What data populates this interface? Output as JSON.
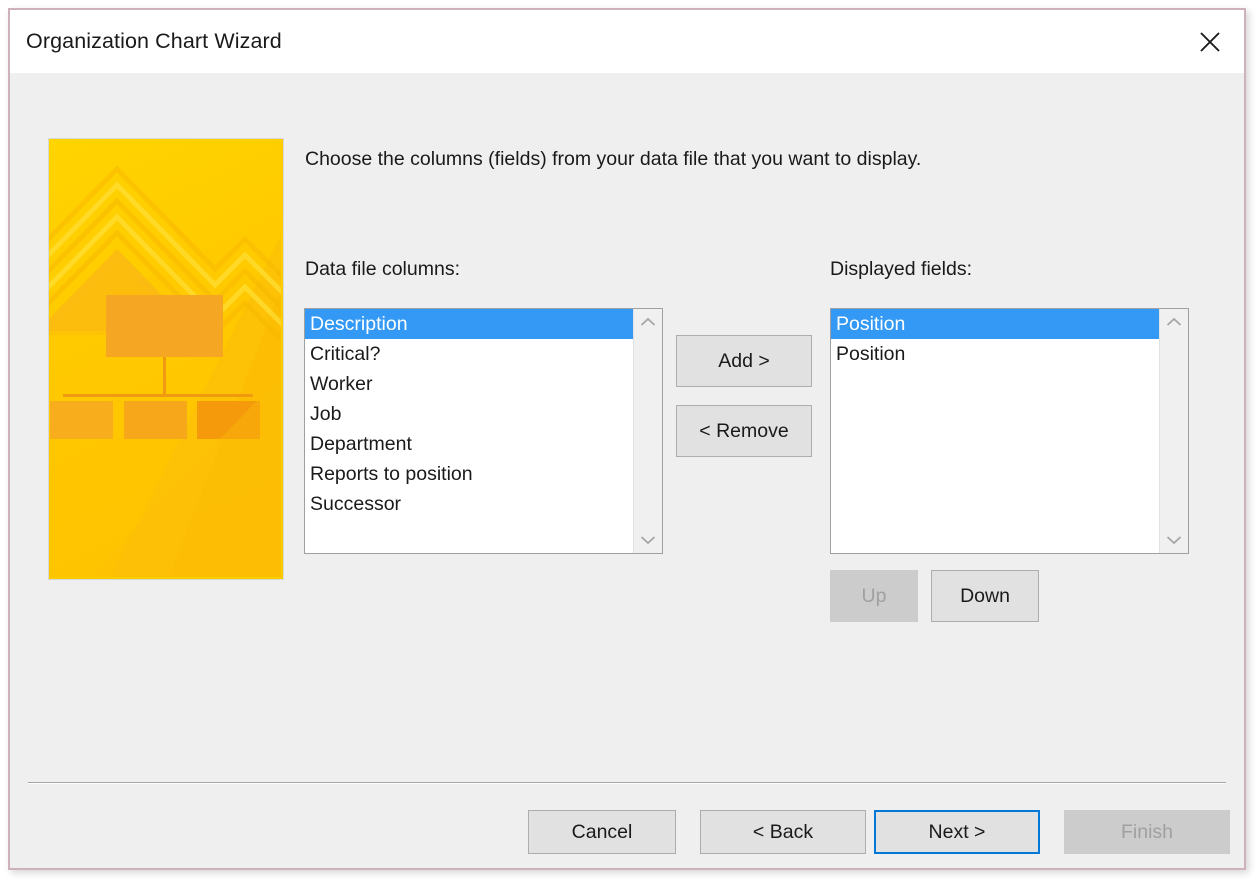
{
  "window": {
    "title": "Organization Chart Wizard",
    "close_icon": "close-icon"
  },
  "content": {
    "instruction": "Choose the columns (fields) from your data file that you want to display.",
    "left_label": "Data file columns:",
    "right_label": "Displayed fields:"
  },
  "data_file_columns": {
    "items": [
      {
        "label": "Description",
        "selected": true
      },
      {
        "label": "Critical?",
        "selected": false
      },
      {
        "label": "Worker",
        "selected": false
      },
      {
        "label": "Job",
        "selected": false
      },
      {
        "label": "Department",
        "selected": false
      },
      {
        "label": "Reports to position",
        "selected": false
      },
      {
        "label": "Successor",
        "selected": false
      }
    ]
  },
  "displayed_fields": {
    "items": [
      {
        "label": "Position",
        "selected": true
      },
      {
        "label": "Position",
        "selected": false
      }
    ]
  },
  "transfer_buttons": {
    "add_label": "Add >",
    "remove_label": "< Remove"
  },
  "order_buttons": {
    "up_label": "Up",
    "up_disabled": true,
    "down_label": "Down",
    "down_disabled": false
  },
  "footer": {
    "cancel_label": "Cancel",
    "back_label": "< Back",
    "next_label": "Next >",
    "next_focused": true,
    "finish_label": "Finish",
    "finish_disabled": true
  },
  "colors": {
    "selection_blue": "#3399f5",
    "focus_blue": "#0078d7",
    "window_border": "#cdb2b9",
    "dialog_background": "#efefef",
    "titlebar_background": "#ffffff",
    "button_face": "#e1e1e1",
    "button_border": "#adadad",
    "disabled_face": "#cccccc",
    "disabled_text": "#a0a0a0",
    "banner_yellow": "#ffcc00",
    "banner_orange": "#f5a623"
  }
}
